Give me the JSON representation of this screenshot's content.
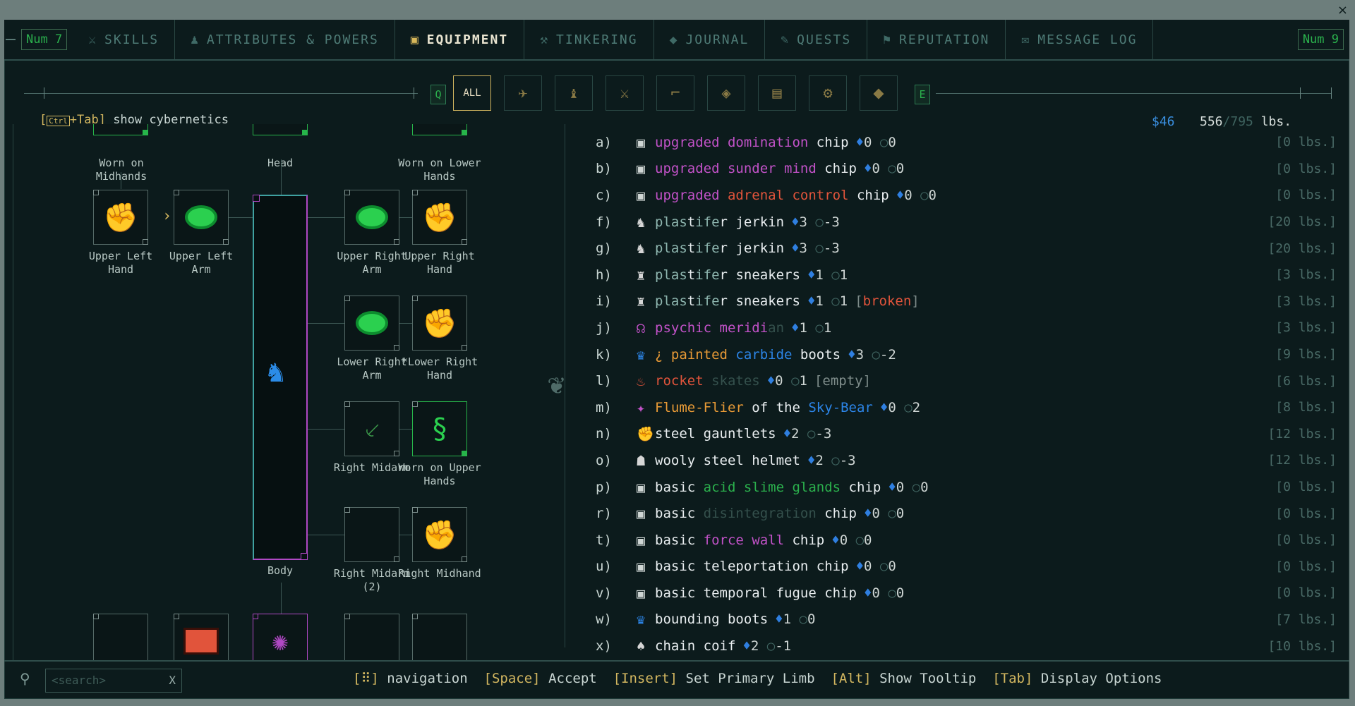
{
  "window": {
    "close_glyph": "×"
  },
  "tabs": {
    "left_key": "Num 7",
    "right_key": "Num 9",
    "items": [
      {
        "label": "SKILLS",
        "icon": "sword-icon"
      },
      {
        "label": "ATTRIBUTES & POWERS",
        "icon": "figure-icon"
      },
      {
        "label": "EQUIPMENT",
        "icon": "chest-icon",
        "active": true
      },
      {
        "label": "TINKERING",
        "icon": "anvil-icon"
      },
      {
        "label": "JOURNAL",
        "icon": "book-icon"
      },
      {
        "label": "QUESTS",
        "icon": "quill-icon"
      },
      {
        "label": "REPUTATION",
        "icon": "banner-icon"
      },
      {
        "label": "MESSAGE LOG",
        "icon": "feather-icon"
      }
    ]
  },
  "filters": {
    "prev_key": "Q",
    "next_key": "E",
    "all_label": "ALL",
    "icons": [
      "duck-icon",
      "creature-icon",
      "sword-icon",
      "pistol-icon",
      "grenade-icon",
      "scroll-icon",
      "tool-icon",
      "ammo-icon"
    ]
  },
  "header": {
    "cyber_key": "Ctrl",
    "cyber_plus": "+Tab]",
    "cyber_open": "[",
    "cyber_text": "show cybernetics",
    "money": "$46",
    "weight": "556",
    "weight_cap": "/795",
    "weight_unit": "lbs."
  },
  "slots": {
    "worn_on_midhands": "Worn on Midhands",
    "head": "Head",
    "worn_on_lower_hands": "Worn on Lower Hands",
    "upper_left_hand": "Upper Left Hand",
    "upper_left_arm": "Upper Left Arm",
    "upper_right_arm": "Upper Right Arm",
    "upper_right_hand": "Upper Right Hand",
    "lower_right_arm": "Lower Right Arm",
    "lower_right_hand": "*Lower Right Hand",
    "right_midarm": "Right Midarm",
    "worn_on_upper_hands": "Worn on Upper Hands",
    "body": "Body",
    "right_midarm_2": "Right Midarm (2)",
    "right_midhand": "Right Midhand"
  },
  "inventory": [
    {
      "key": "a)",
      "icon": "chip-icon",
      "parts": [
        [
          "upgraded ",
          "mag"
        ],
        [
          "domination",
          "mag"
        ],
        [
          " chip",
          "white"
        ]
      ],
      "av": "0",
      "dv": "0",
      "weight": "[0 lbs.]"
    },
    {
      "key": "b)",
      "icon": "chip-icon",
      "parts": [
        [
          "upgraded ",
          "mag"
        ],
        [
          "sunder mind",
          "mag"
        ],
        [
          " chip",
          "white"
        ]
      ],
      "av": "0",
      "dv": "0",
      "weight": "[0 lbs.]"
    },
    {
      "key": "c)",
      "icon": "chip-icon",
      "parts": [
        [
          "upgraded ",
          "mag"
        ],
        [
          "adrenal control",
          "red"
        ],
        [
          " chip",
          "white"
        ]
      ],
      "av": "0",
      "dv": "0",
      "weight": "[0 lbs.]"
    },
    {
      "key": "f)",
      "icon": "jerkin-icon",
      "parts": [
        [
          "plas",
          "teal"
        ],
        [
          "t",
          "white"
        ],
        [
          "ife",
          "teal"
        ],
        [
          "r",
          "white"
        ],
        [
          " jerkin",
          "white"
        ]
      ],
      "av": "3",
      "dv": "-3",
      "weight": "[20 lbs.]"
    },
    {
      "key": "g)",
      "icon": "jerkin-icon",
      "parts": [
        [
          "plas",
          "teal"
        ],
        [
          "t",
          "white"
        ],
        [
          "ife",
          "teal"
        ],
        [
          "r",
          "white"
        ],
        [
          " jerkin",
          "white"
        ]
      ],
      "av": "3",
      "dv": "-3",
      "weight": "[20 lbs.]"
    },
    {
      "key": "h)",
      "icon": "sneakers-icon",
      "parts": [
        [
          "plas",
          "teal"
        ],
        [
          "t",
          "white"
        ],
        [
          "ife",
          "teal"
        ],
        [
          "r",
          "white"
        ],
        [
          " sneakers",
          "white"
        ]
      ],
      "av": "1",
      "dv": "1",
      "weight": "[3 lbs.]"
    },
    {
      "key": "i)",
      "icon": "sneakers-icon",
      "parts": [
        [
          "plas",
          "teal"
        ],
        [
          "t",
          "white"
        ],
        [
          "ife",
          "teal"
        ],
        [
          "r",
          "white"
        ],
        [
          " sneakers",
          "white"
        ]
      ],
      "av": "1",
      "dv": "1",
      "suffix": [
        [
          "[",
          "grey"
        ],
        [
          "broken",
          "red"
        ],
        [
          "]",
          "grey"
        ]
      ],
      "weight": "[3 lbs.]"
    },
    {
      "key": "j)",
      "icon": "meridian-icon",
      "parts": [
        [
          "psychic meridi",
          "mag"
        ],
        [
          "an",
          "dim"
        ]
      ],
      "av": "1",
      "dv": "1",
      "weight": "[3 lbs.]"
    },
    {
      "key": "k)",
      "icon": "boots-icon",
      "parts": [
        [
          "¿ ",
          "orange"
        ],
        [
          "painted",
          "orange"
        ],
        [
          " carbide",
          "blue"
        ],
        [
          " boots",
          "white"
        ]
      ],
      "av": "3",
      "dv": "-2",
      "weight": "[9 lbs.]"
    },
    {
      "key": "l)",
      "icon": "skates-icon",
      "parts": [
        [
          "rocket",
          "red"
        ],
        [
          " skates",
          "dim"
        ]
      ],
      "av": "0",
      "dv": "1",
      "suffix": [
        [
          "[",
          "grey"
        ],
        [
          "empty",
          "grey"
        ],
        [
          "]",
          "grey"
        ]
      ],
      "weight": "[6 lbs.]"
    },
    {
      "key": "m)",
      "icon": "flier-icon",
      "parts": [
        [
          "Flume-Flier",
          "orange"
        ],
        [
          " of the ",
          "white"
        ],
        [
          "Sky-Bear",
          "blue"
        ]
      ],
      "av": "0",
      "dv": "2",
      "weight": "[8 lbs.]"
    },
    {
      "key": "n)",
      "icon": "gauntlets-icon",
      "parts": [
        [
          "steel gauntlets",
          "white"
        ]
      ],
      "av": "2",
      "dv": "-3",
      "weight": "[12 lbs.]"
    },
    {
      "key": "o)",
      "icon": "helmet-icon",
      "parts": [
        [
          "wooly steel helmet",
          "white"
        ]
      ],
      "av": "2",
      "dv": "-3",
      "weight": "[12 lbs.]"
    },
    {
      "key": "p)",
      "icon": "chip-icon",
      "parts": [
        [
          "basic ",
          "white"
        ],
        [
          "acid slime glands",
          "green"
        ],
        [
          " chip",
          "white"
        ]
      ],
      "av": "0",
      "dv": "0",
      "weight": "[0 lbs.]"
    },
    {
      "key": "r)",
      "icon": "chip-icon",
      "parts": [
        [
          "basic ",
          "white"
        ],
        [
          "disintegration",
          "dim"
        ],
        [
          " chip",
          "white"
        ]
      ],
      "av": "0",
      "dv": "0",
      "weight": "[0 lbs.]"
    },
    {
      "key": "t)",
      "icon": "chip-icon",
      "parts": [
        [
          "basic ",
          "white"
        ],
        [
          "force wall",
          "mag"
        ],
        [
          " chip",
          "white"
        ]
      ],
      "av": "0",
      "dv": "0",
      "weight": "[0 lbs.]"
    },
    {
      "key": "u)",
      "icon": "chip-icon",
      "parts": [
        [
          "basic ",
          "white"
        ],
        [
          "teleportation",
          "white"
        ],
        [
          " chip",
          "white"
        ]
      ],
      "av": "0",
      "dv": "0",
      "weight": "[0 lbs.]"
    },
    {
      "key": "v)",
      "icon": "chip-icon",
      "parts": [
        [
          "basic temporal fugue chip",
          "white"
        ]
      ],
      "av": "0",
      "dv": "0",
      "weight": "[0 lbs.]"
    },
    {
      "key": "w)",
      "icon": "boots-icon",
      "parts": [
        [
          "bounding boots",
          "white"
        ]
      ],
      "av": "1",
      "dv": "0",
      "weight": "[7 lbs.]"
    },
    {
      "key": "x)",
      "icon": "coif-icon",
      "parts": [
        [
          "chain coif",
          "white"
        ]
      ],
      "av": "2",
      "dv": "-1",
      "weight": "[10 lbs.]"
    }
  ],
  "bottom": {
    "search_placeholder": "<search>",
    "search_clear": "X",
    "hints": [
      {
        "k": "[",
        "v": ""
      },
      {
        "k": "]",
        "v": " navigation  "
      },
      {
        "k": "[Space]",
        "v": " Accept  "
      },
      {
        "k": "[Insert]",
        "v": " Set Primary Limb  "
      },
      {
        "k": "[Alt]",
        "v": " Show Tooltip  "
      },
      {
        "k": "[Tab]",
        "v": " Display Options"
      }
    ]
  }
}
